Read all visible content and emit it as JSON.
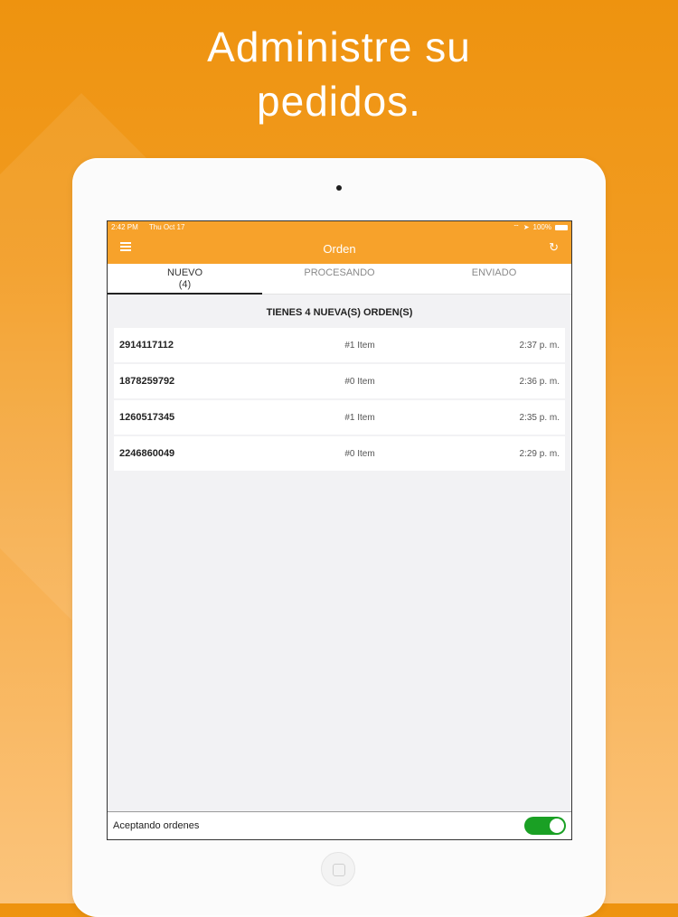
{
  "headline": {
    "line1": "Administre su",
    "line2": "pedidos."
  },
  "status_bar": {
    "time": "2:42 PM",
    "date": "Thu Oct 17",
    "battery": "100%"
  },
  "header": {
    "title": "Orden"
  },
  "tabs": [
    {
      "label": "NUEVO",
      "count": "(4)"
    },
    {
      "label": "PROCESANDO"
    },
    {
      "label": "ENVIADO"
    }
  ],
  "orders_summary": "TIENES 4 NUEVA(S) ORDEN(S)",
  "orders": [
    {
      "id": "2914117112",
      "items": "#1 Item",
      "time": "2:37 p. m."
    },
    {
      "id": "1878259792",
      "items": "#0 Item",
      "time": "2:36 p. m."
    },
    {
      "id": "1260517345",
      "items": "#1 Item",
      "time": "2:35 p. m."
    },
    {
      "id": "2246860049",
      "items": "#0 Item",
      "time": "2:29 p. m."
    }
  ],
  "footer": {
    "label": "Aceptando ordenes",
    "toggle_on": true
  },
  "colors": {
    "accent": "#f7a22b",
    "toggle": "#1aa024"
  },
  "icons": [
    "menu-icon",
    "refresh-icon",
    "wifi-icon",
    "location-icon",
    "battery-icon"
  ]
}
